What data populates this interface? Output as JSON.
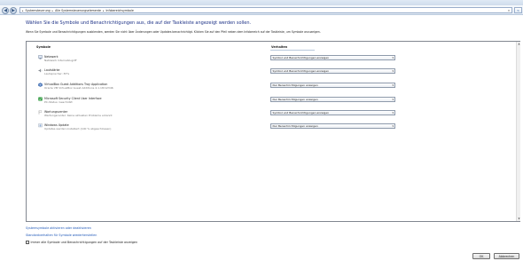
{
  "address": {
    "crumbs": [
      "Systemsteuerung",
      "Alle Systemsteuerungselemente",
      "Infobereichsymbole"
    ],
    "separator": "▸",
    "back_glyph": "◀",
    "forward_glyph": "▶",
    "dropdown_glyph": "▾",
    "refresh_glyph": "↻"
  },
  "page": {
    "heading": "Wählen Sie die Symbole und Benachrichtigungen aus, die auf der Taskleiste angezeigt werden sollen.",
    "intro": "Wenn Sie Symbole und Benachrichtigungen ausblenden, werden Sie nicht über Änderungen oder Updates benachrichtigt. Klicken Sie auf den Pfeil neben dem Infobereich auf der Taskleiste, um Symbole anzuzeigen."
  },
  "table": {
    "col_symbols": "Symbole",
    "col_behavior": "Verhalten",
    "rows": [
      {
        "name": "Netzwerk",
        "desc": "Netzwerk Internetzugriff",
        "behavior": "Symbol und Benachrichtigungen anzeigen",
        "icon": "network-icon"
      },
      {
        "name": "Lautstärke",
        "desc": "Lautsprecher: 87%",
        "behavior": "Symbol und Benachrichtigungen anzeigen",
        "icon": "speaker-icon"
      },
      {
        "name": "VirtualBox Guest Additions Tray Application",
        "desc": "Oracle VM VirtualBox Guest Additions 4.1.18r12346",
        "behavior": "Nur Benachrichtigungen anzeigen",
        "icon": "virtualbox-icon"
      },
      {
        "name": "Microsoft Security Client User Interface",
        "desc": "PC-Status: Geschützt",
        "behavior": "Nur Benachrichtigungen anzeigen",
        "icon": "security-icon"
      },
      {
        "name": "Wartungscenter",
        "desc": "Wartungscenter: Keine aktuellen Probleme erkannt",
        "behavior": "Symbol und Benachrichtigungen anzeigen",
        "icon": "flag-icon"
      },
      {
        "name": "Windows Update",
        "desc": "Updates werden installiert (100 % abgeschlossen)",
        "behavior": "Nur Benachrichtigungen anzeigen",
        "icon": "windows-update-icon"
      }
    ],
    "dropdown_arrow": "▾",
    "scroll_up": "▲",
    "scroll_down": "▼"
  },
  "links": {
    "system_icons": "Systemsymbole aktivieren oder deaktivieren",
    "restore_defaults": "Standardverhalten für Symbole wiederherstellen"
  },
  "checkbox": {
    "label": "Immer alle Symbole und Benachrichtigungen auf der Taskleiste anzeigen",
    "checked": false
  },
  "buttons": {
    "ok": "OK",
    "cancel": "Abbrechen"
  },
  "colors": {
    "heading": "#1e3287",
    "link": "#1e57b8"
  }
}
